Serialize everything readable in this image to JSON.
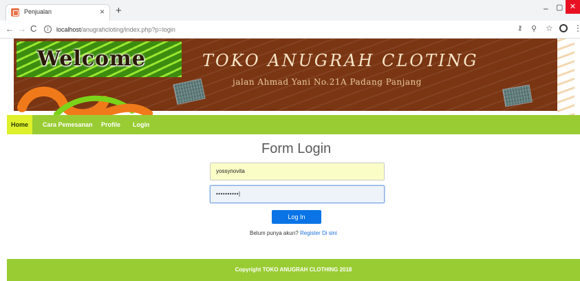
{
  "browser": {
    "tab_title": "Penjualan",
    "tab_close": "×",
    "new_tab": "+",
    "url_host": "localhost",
    "url_path": "/anugrahcloting/index.php?p=login",
    "win_min": "–",
    "win_max": "▢",
    "win_close": "✕"
  },
  "banner": {
    "welcome": "Welcome",
    "store_name": "TOKO ANUGRAH CLOTING",
    "address": "jalan Ahmad Yani No.21A Padang Panjang"
  },
  "nav": {
    "items": [
      "Home",
      "Cara Pemesanan",
      "Profile",
      "Login"
    ]
  },
  "form": {
    "title": "Form Login",
    "username_value": "yossynovita",
    "password_value": "••••••••••|",
    "submit_label": "Log In",
    "register_prompt": "Belum punya akun?",
    "register_link": "Register Di sini"
  },
  "footer": {
    "text": "Copyright TOKO ANUGRAH CLOTHING 2018"
  },
  "colors": {
    "nav_bg": "#99cc33",
    "nav_active": "#ddf02a",
    "banner_brown": "#7a3512",
    "button_blue": "#0a74e6"
  }
}
